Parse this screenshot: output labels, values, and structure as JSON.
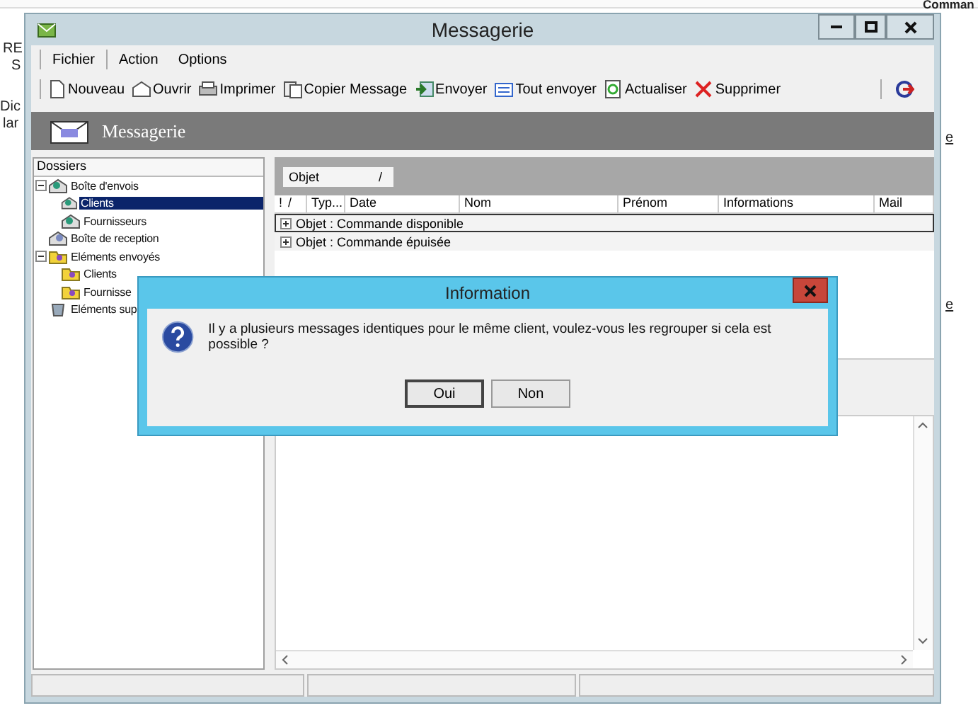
{
  "background": {
    "fragments": [
      {
        "kind": "plain",
        "text": "RE"
      },
      {
        "kind": "plain",
        "text": "S"
      },
      {
        "kind": "plain",
        "text": "Dic"
      },
      {
        "kind": "plain",
        "text": "lar"
      },
      {
        "kind": "bold",
        "text": "Comman"
      },
      {
        "kind": "link",
        "text": "e"
      },
      {
        "kind": "link",
        "text": "e"
      }
    ]
  },
  "window": {
    "title": "Messagerie"
  },
  "menu": [
    "Fichier",
    "Action",
    "Options"
  ],
  "toolbar": [
    {
      "kind": "new",
      "label": "Nouveau"
    },
    {
      "kind": "open",
      "label": "Ouvrir"
    },
    {
      "kind": "print",
      "label": "Imprimer"
    },
    {
      "kind": "copy",
      "label": "Copier Message"
    },
    {
      "kind": "send",
      "label": "Envoyer"
    },
    {
      "kind": "sendall",
      "label": "Tout envoyer"
    },
    {
      "kind": "refresh",
      "label": "Actualiser"
    },
    {
      "kind": "delete",
      "label": "Supprimer"
    }
  ],
  "header": {
    "title": "Messagerie"
  },
  "folders": {
    "title": "Dossiers",
    "items": [
      {
        "label": "Boîte d'envois",
        "kind": "outbox",
        "expanded": true,
        "selected": false,
        "children": [
          {
            "label": "Clients",
            "kind": "outbox",
            "selected": true
          },
          {
            "label": "Fournisseurs",
            "kind": "outbox",
            "selected": false
          }
        ]
      },
      {
        "label": "Boîte de reception",
        "kind": "inbox",
        "selected": false
      },
      {
        "label": "Eléments envoyés",
        "kind": "sent",
        "expanded": true,
        "selected": false,
        "children": [
          {
            "label": "Clients",
            "kind": "sent",
            "selected": false
          },
          {
            "label": "Fournisse",
            "kind": "sent",
            "selected": false
          }
        ]
      },
      {
        "label": "Eléments sup",
        "kind": "trash",
        "selected": false
      }
    ]
  },
  "group_by": {
    "label": "Objet",
    "sort_mark": "/"
  },
  "table": {
    "columns": [
      {
        "label": "!",
        "sort_mark": "/"
      },
      {
        "label": "Typ..."
      },
      {
        "label": "Date"
      },
      {
        "label": "Nom"
      },
      {
        "label": "Prénom"
      },
      {
        "label": "Informations"
      },
      {
        "label": "Mail"
      }
    ],
    "groups": [
      {
        "label": "Objet : Commande disponible",
        "expanded": false,
        "focused": true
      },
      {
        "label": "Objet : Commande épuisée",
        "expanded": false,
        "focused": false
      }
    ]
  },
  "dialog": {
    "title": "Information",
    "message": "Il y a plusieurs messages identiques pour le même client, voulez-vous les regrouper si cela est possible ?",
    "buttons": [
      {
        "label": "Oui",
        "selected": true
      },
      {
        "label": "Non",
        "selected": false
      }
    ]
  }
}
